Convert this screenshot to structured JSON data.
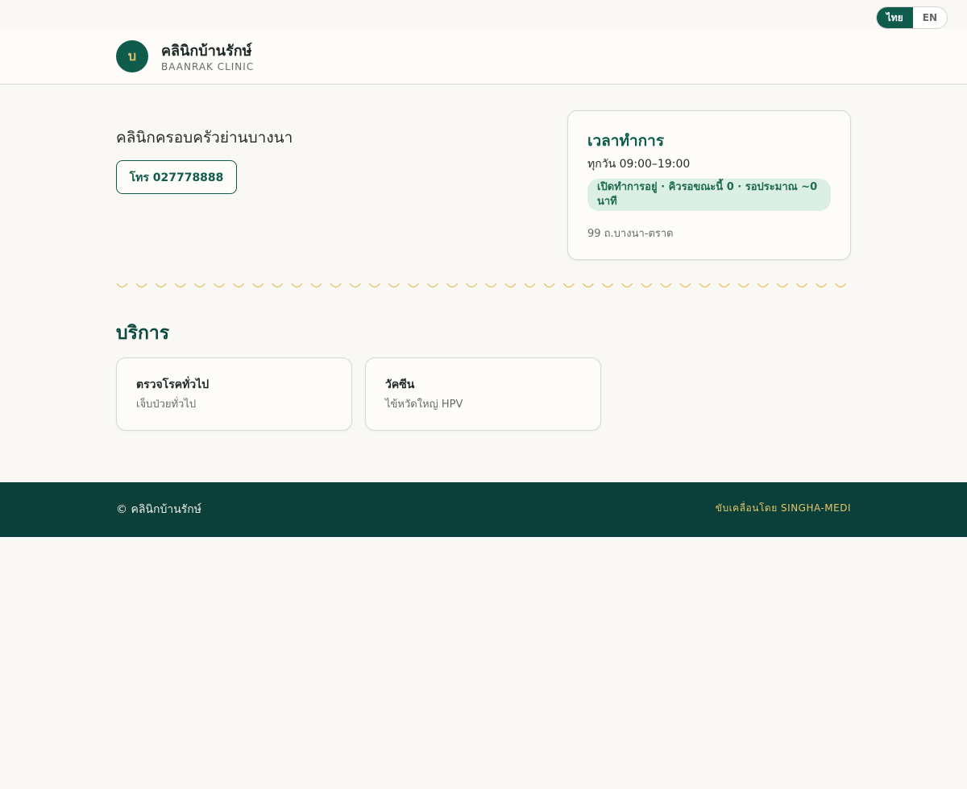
{
  "language": {
    "options": [
      "ไทย",
      "EN"
    ],
    "selected": "ไทย"
  },
  "header": {
    "logo_letter": "บ",
    "name": "คลินิกบ้านรักษ์",
    "subtitle": "BAANRAK CLINIC"
  },
  "hero": {
    "tagline": "คลินิกครอบครัวย่านบางนา",
    "call_label": "โทร 027778888"
  },
  "hours": {
    "title": "เวลาทำการ",
    "schedule": "ทุกวัน 09:00–19:00",
    "status": "เปิดทำการอยู่ · คิวรอขณะนี้ 0 · รอประมาณ ~0 นาที",
    "address": "99 ถ.บางนา-ตราด"
  },
  "services": {
    "title": "บริการ",
    "items": [
      {
        "name": "ตรวจโรคทั่วไป",
        "desc": "เจ็บป่วยทั่วไป"
      },
      {
        "name": "วัคซีน",
        "desc": "ไข้หวัดใหญ่ HPV"
      }
    ]
  },
  "footer": {
    "copyright": "© คลินิกบ้านรักษ์",
    "powered": "ขับเคลื่อนโดย SINGHA-MEDI"
  },
  "colors": {
    "brand": "#0f5b4c",
    "accent": "#e7c46a",
    "footer_bg": "#0b403a",
    "status_bg": "#dcefe4"
  }
}
